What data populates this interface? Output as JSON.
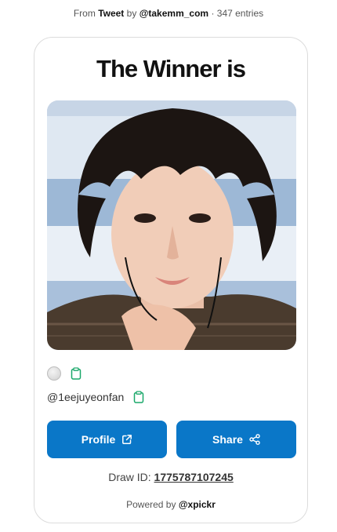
{
  "header": {
    "from_prefix": "From",
    "source_link": "Tweet",
    "by_word": "by",
    "author_link": "@takemm_com",
    "entries": "· 347 entries"
  },
  "card": {
    "title": "The Winner is",
    "username": "@1eejuyeonfan",
    "profile_button": "Profile",
    "share_button": "Share",
    "draw_id_label": "Draw ID:",
    "draw_id_value": "1775787107245",
    "powered_prefix": "Powered by",
    "powered_brand": "@xpickr"
  },
  "colors": {
    "accent": "#0a77c8",
    "clipboard_icon": "#1aa86a"
  },
  "icons": {
    "status": "gray-circle-icon",
    "copy": "clipboard-icon",
    "profile": "external-link-icon",
    "share": "share-icon"
  }
}
